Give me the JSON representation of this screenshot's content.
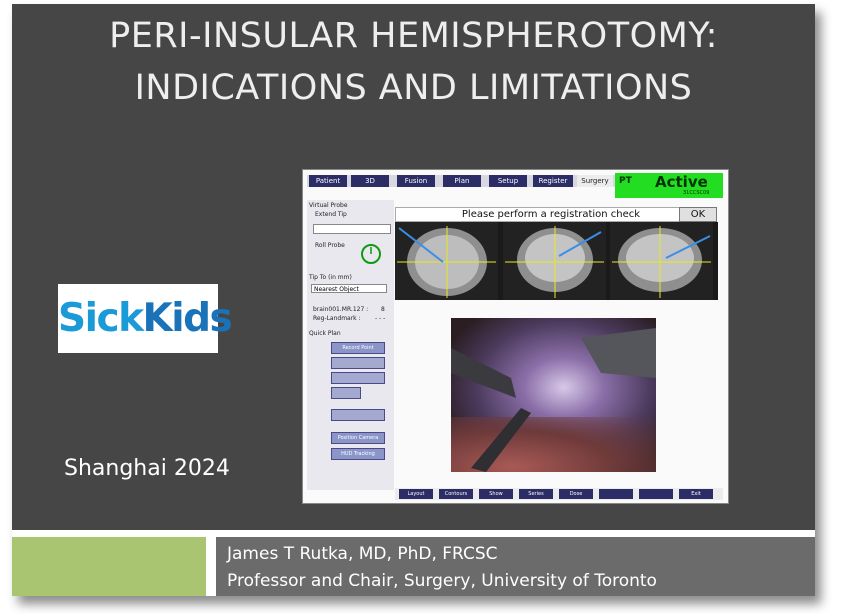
{
  "slide": {
    "title_line1": "PERI-INSULAR HEMISPHEROTOMY:",
    "title_line2": "INDICATIONS AND LIMITATIONS",
    "logo_part1": "Sick",
    "logo_part2": "Kids",
    "location_year": "Shanghai 2024",
    "author_line1": "James T Rutka, MD, PhD, FRCSC",
    "author_line2": "Professor and Chair, Surgery, University of Toronto",
    "colors": {
      "background": "#464646",
      "accent_green": "#9bbb59",
      "footer_gray": "#6b6b6b",
      "logo_blue": "#1a9ad7"
    }
  },
  "nav_screen": {
    "tabs": [
      "Patient",
      "3D",
      "Fusion",
      "Plan",
      "Setup",
      "Register",
      "Surgery"
    ],
    "selected_tab": "Surgery",
    "status_prefix": "PT",
    "status": "Active",
    "status_code": "31CCSC09",
    "message": "Please perform a registration check",
    "ok_label": "OK",
    "left_panel": {
      "virtual_probe": "Virtual Probe",
      "extend_tip": "Extend Tip",
      "roll_probe": "Roll Probe",
      "tip_to": "Tip To     (in mm)",
      "tip_select": "Nearest Object",
      "brain_label": "brain001.MR.127 :",
      "brain_value": "8",
      "reg_landmark": "Reg-Landmark :",
      "reg_value": "- - -",
      "quick_plan": "Quick Plan",
      "buttons": [
        "Record Point",
        "",
        "",
        "",
        "",
        "Position Camera",
        "HUD Tracking"
      ]
    },
    "bottom_buttons": [
      "Layout",
      "Contours",
      "Show",
      "Series",
      "Dose",
      "",
      "",
      "Exit"
    ]
  }
}
